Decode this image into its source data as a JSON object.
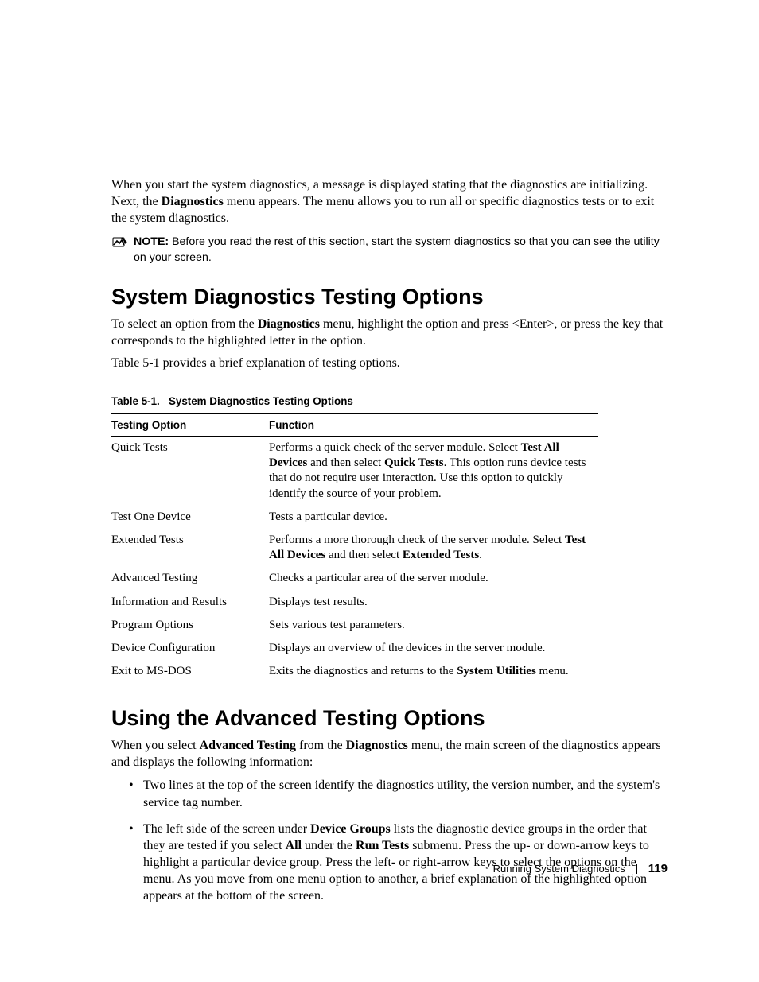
{
  "intro": {
    "p1_a": "When you start the system diagnostics, a message is displayed stating that the diagnostics are initializing. Next, the ",
    "p1_bold": "Diagnostics",
    "p1_b": " menu appears. The menu allows you to run all or specific diagnostics tests or to exit the system diagnostics."
  },
  "note": {
    "label": "NOTE: ",
    "text": "Before you read the rest of this section, start the system diagnostics so that you can see the utility on your screen."
  },
  "section1": {
    "heading": "System Diagnostics Testing Options",
    "p1_a": "To select an option from the ",
    "p1_bold": "Diagnostics",
    "p1_b": " menu, highlight the option and press <Enter>, or press the key that corresponds to the highlighted letter in the option.",
    "p2": "Table 5-1 provides a brief explanation of testing options."
  },
  "table": {
    "caption_a": "Table 5-1.",
    "caption_b": "System Diagnostics Testing Options",
    "head_option": "Testing Option",
    "head_function": "Function",
    "rows": [
      {
        "option": "Quick Tests",
        "fn_a": "Performs a quick check of the server module. Select ",
        "fn_b1": "Test All Devices",
        "fn_c": " and then select ",
        "fn_b2": "Quick Tests",
        "fn_d": ". This option runs device tests that do not require user interaction. Use this option to quickly identify the source of your problem."
      },
      {
        "option": "Test One Device",
        "fn_a": "Tests a particular device."
      },
      {
        "option": "Extended Tests",
        "fn_a": "Performs a more thorough check of the server module. Select ",
        "fn_b1": "Test All Devices",
        "fn_c": " and then select ",
        "fn_b2": "Extended Tests",
        "fn_d": "."
      },
      {
        "option": "Advanced Testing",
        "fn_a": "Checks a particular area of the server module."
      },
      {
        "option": "Information and Results",
        "fn_a": "Displays test results."
      },
      {
        "option": "Program Options",
        "fn_a": "Sets various test parameters."
      },
      {
        "option": "Device Configuration",
        "fn_a": "Displays an overview of the devices in the server module."
      },
      {
        "option": "Exit to MS-DOS",
        "fn_a": "Exits the diagnostics and returns to the ",
        "fn_b1": "System Utilities",
        "fn_c": " menu."
      }
    ]
  },
  "section2": {
    "heading": "Using the Advanced Testing Options",
    "p1_a": "When you select ",
    "p1_b1": "Advanced Testing",
    "p1_b": " from the ",
    "p1_b2": "Diagnostics",
    "p1_c": " menu, the main screen of the diagnostics appears and displays the following information:",
    "bullet1": "Two lines at the top of the screen identify the diagnostics utility, the version number, and the system's service tag number.",
    "bullet2_a": "The left side of the screen under ",
    "bullet2_b1": "Device Groups",
    "bullet2_b": " lists the diagnostic device groups in the order that they are tested if you select ",
    "bullet2_b2": "All",
    "bullet2_c": " under the ",
    "bullet2_b3": "Run Tests",
    "bullet2_d": " submenu. Press the up- or down-arrow keys to highlight a particular device group. Press the left- or right-arrow keys to select the options on the menu. As you move from one menu option to another, a brief explanation of the highlighted option appears at the bottom of the screen."
  },
  "footer": {
    "chapter": "Running System Diagnostics",
    "page": "119"
  }
}
